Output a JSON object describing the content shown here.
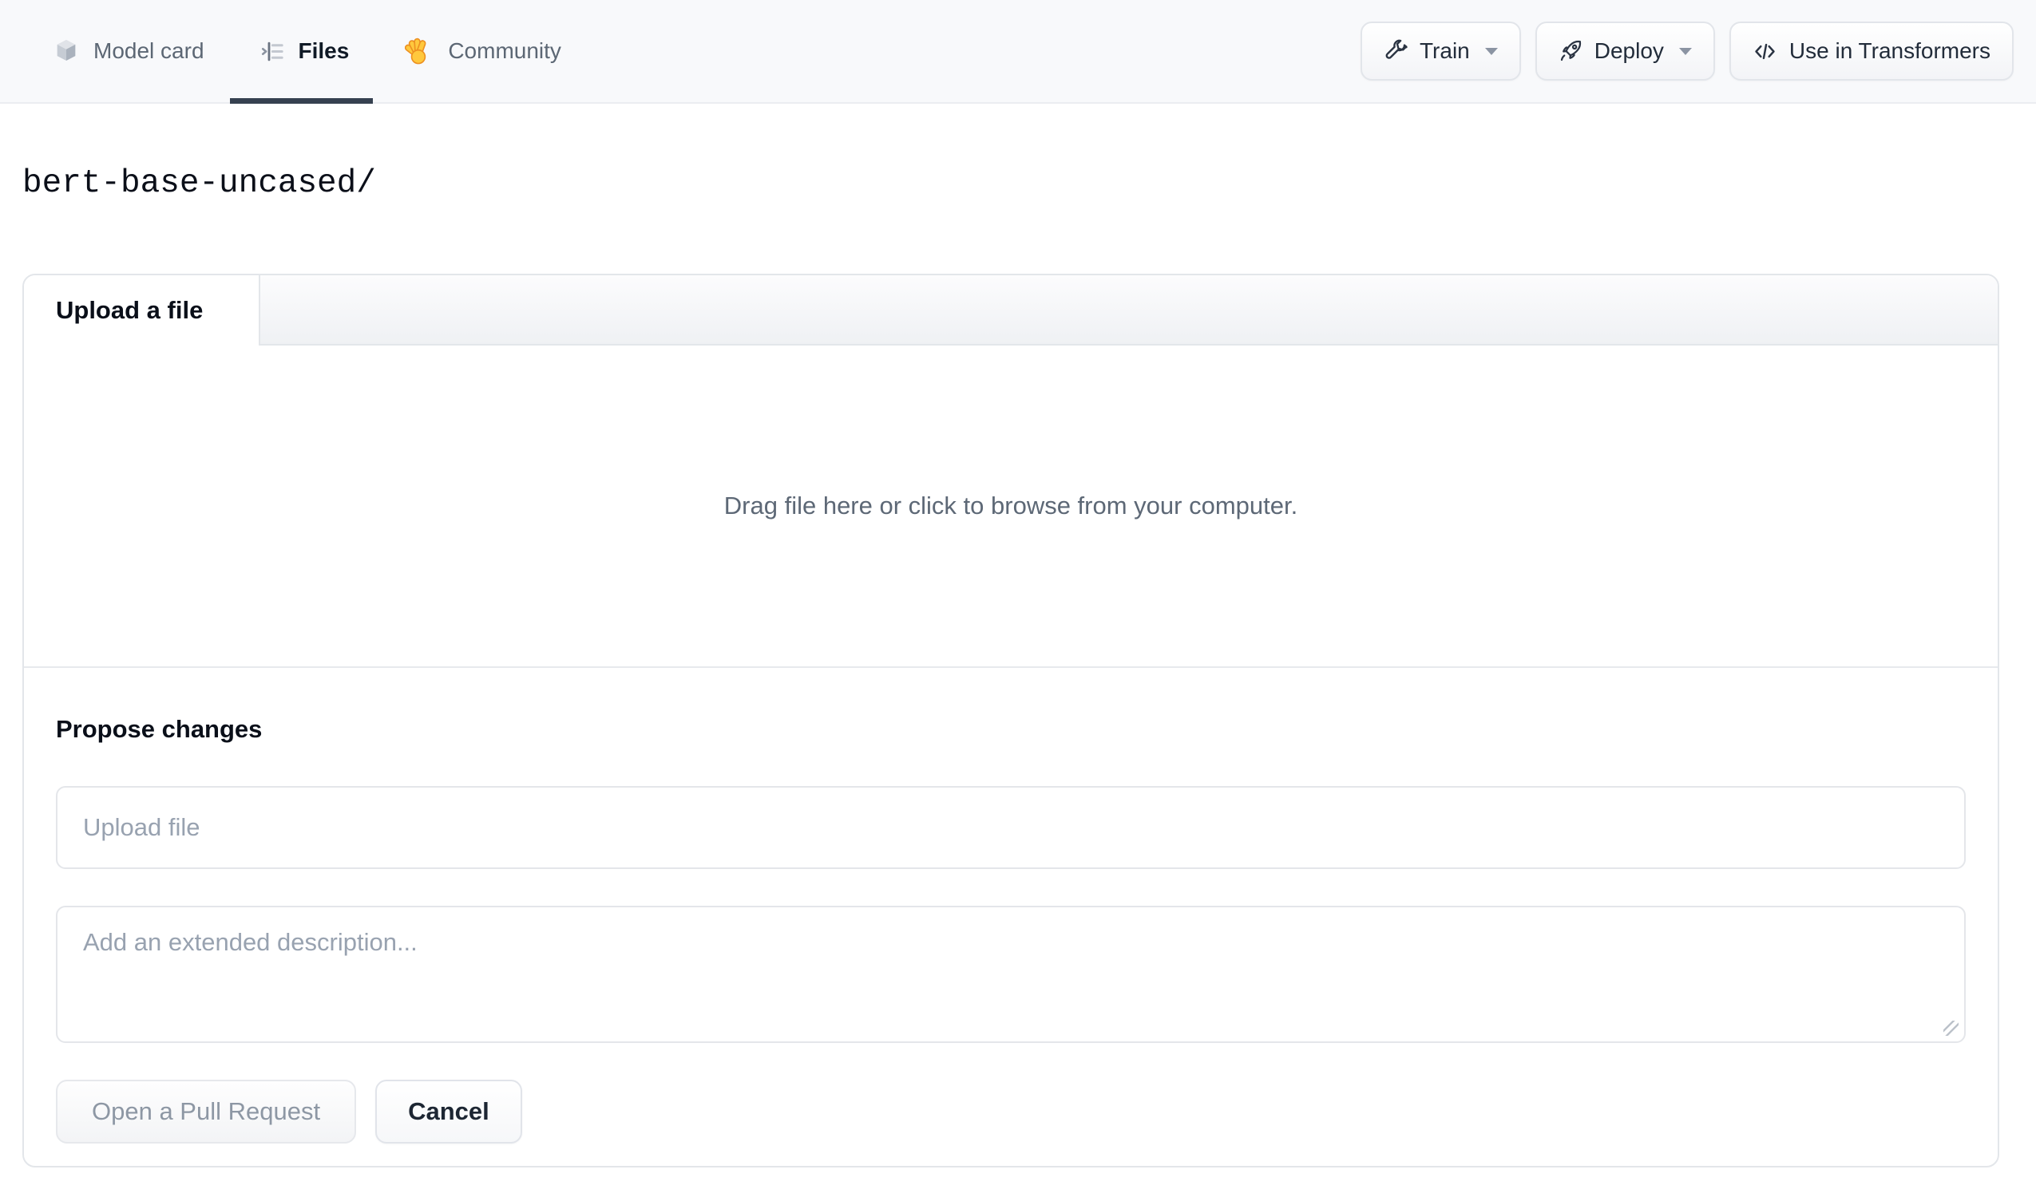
{
  "nav": {
    "tabs": [
      {
        "label": "Model card",
        "icon": "cube-icon",
        "active": false
      },
      {
        "label": "Files",
        "icon": "files-list-icon",
        "active": true
      },
      {
        "label": "Community",
        "icon": "waving-hand-icon",
        "active": false
      }
    ],
    "buttons": [
      {
        "label": "Train",
        "icon": "wrench-icon",
        "has_dropdown": true
      },
      {
        "label": "Deploy",
        "icon": "rocket-icon",
        "has_dropdown": true
      },
      {
        "label": "Use in Transformers",
        "icon": "code-icon",
        "has_dropdown": false
      }
    ]
  },
  "path_header": {
    "text": "bert-base-uncased/"
  },
  "upload_card": {
    "active_tab": "Upload a file",
    "dropzone_hint": "Drag file here or click to browse from your computer."
  },
  "propose_changes": {
    "heading": "Propose changes",
    "filename_input": {
      "value": "",
      "placeholder": "Upload file"
    },
    "description_input": {
      "value": "",
      "placeholder": "Add an extended description..."
    },
    "open_pr_button": "Open a Pull Request",
    "cancel_button": "Cancel"
  },
  "colors": {
    "nav_background": "#f8f9fb",
    "nav_active_underline": "#364150",
    "nav_inactive_text": "#5c6774",
    "panel_border": "#e3e6ea",
    "muted_text": "#5d6876",
    "placeholder_text": "#98a2b0",
    "disabled_button_text": "#8d97a4",
    "hand_emoji_yellow": "#ffc83d"
  }
}
